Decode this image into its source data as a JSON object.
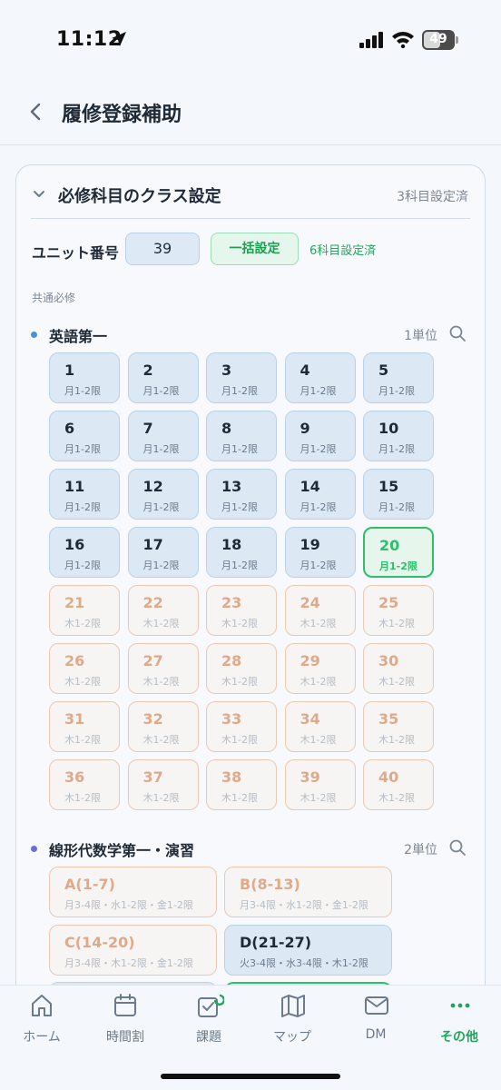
{
  "status_bar": {
    "time": "11:12",
    "battery": "49"
  },
  "header": {
    "title": "履修登録補助"
  },
  "section": {
    "title": "必修科目のクラス設定",
    "status": "3科目設定済",
    "unit_label": "ユニット番号",
    "unit_value": "39",
    "bulk_button": "一括設定",
    "bulk_status": "6科目設定済",
    "category": "共通必修"
  },
  "subjects": [
    {
      "name": "英語第一",
      "credits": "1単位",
      "classes": [
        {
          "num": "1",
          "period": "月1-2限",
          "state": "on"
        },
        {
          "num": "2",
          "period": "月1-2限",
          "state": "on"
        },
        {
          "num": "3",
          "period": "月1-2限",
          "state": "on"
        },
        {
          "num": "4",
          "period": "月1-2限",
          "state": "on"
        },
        {
          "num": "5",
          "period": "月1-2限",
          "state": "on"
        },
        {
          "num": "6",
          "period": "月1-2限",
          "state": "on"
        },
        {
          "num": "7",
          "period": "月1-2限",
          "state": "on"
        },
        {
          "num": "8",
          "period": "月1-2限",
          "state": "on"
        },
        {
          "num": "9",
          "period": "月1-2限",
          "state": "on"
        },
        {
          "num": "10",
          "period": "月1-2限",
          "state": "on"
        },
        {
          "num": "11",
          "period": "月1-2限",
          "state": "on"
        },
        {
          "num": "12",
          "period": "月1-2限",
          "state": "on"
        },
        {
          "num": "13",
          "period": "月1-2限",
          "state": "on"
        },
        {
          "num": "14",
          "period": "月1-2限",
          "state": "on"
        },
        {
          "num": "15",
          "period": "月1-2限",
          "state": "on"
        },
        {
          "num": "16",
          "period": "月1-2限",
          "state": "on"
        },
        {
          "num": "17",
          "period": "月1-2限",
          "state": "on"
        },
        {
          "num": "18",
          "period": "月1-2限",
          "state": "on"
        },
        {
          "num": "19",
          "period": "月1-2限",
          "state": "on"
        },
        {
          "num": "20",
          "period": "月1-2限",
          "state": "sel"
        },
        {
          "num": "21",
          "period": "木1-2限",
          "state": "off"
        },
        {
          "num": "22",
          "period": "木1-2限",
          "state": "off"
        },
        {
          "num": "23",
          "period": "木1-2限",
          "state": "off"
        },
        {
          "num": "24",
          "period": "木1-2限",
          "state": "off"
        },
        {
          "num": "25",
          "period": "木1-2限",
          "state": "off"
        },
        {
          "num": "26",
          "period": "木1-2限",
          "state": "off"
        },
        {
          "num": "27",
          "period": "木1-2限",
          "state": "off"
        },
        {
          "num": "28",
          "period": "木1-2限",
          "state": "off"
        },
        {
          "num": "29",
          "period": "木1-2限",
          "state": "off"
        },
        {
          "num": "30",
          "period": "木1-2限",
          "state": "off"
        },
        {
          "num": "31",
          "period": "木1-2限",
          "state": "off"
        },
        {
          "num": "32",
          "period": "木1-2限",
          "state": "off"
        },
        {
          "num": "33",
          "period": "木1-2限",
          "state": "off"
        },
        {
          "num": "34",
          "period": "木1-2限",
          "state": "off"
        },
        {
          "num": "35",
          "period": "木1-2限",
          "state": "off"
        },
        {
          "num": "36",
          "period": "木1-2限",
          "state": "off"
        },
        {
          "num": "37",
          "period": "木1-2限",
          "state": "off"
        },
        {
          "num": "38",
          "period": "木1-2限",
          "state": "off"
        },
        {
          "num": "39",
          "period": "木1-2限",
          "state": "off"
        },
        {
          "num": "40",
          "period": "木1-2限",
          "state": "off"
        }
      ]
    },
    {
      "name": "線形代数学第一・演習",
      "credits": "2単位",
      "classes": [
        {
          "num": "A(1-7)",
          "period": "月3-4限・水1-2限・金1-2限",
          "state": "off"
        },
        {
          "num": "B(8-13)",
          "period": "月3-4限・水1-2限・金1-2限",
          "state": "off"
        },
        {
          "num": "C(14-20)",
          "period": "月3-4限・木1-2限・金1-2限",
          "state": "off"
        },
        {
          "num": "D(21-27)",
          "period": "火3-4限・水3-4限・木1-2限",
          "state": "on"
        }
      ]
    }
  ],
  "tabs": [
    {
      "label": "ホーム",
      "icon": "home-icon"
    },
    {
      "label": "時間割",
      "icon": "calendar-icon"
    },
    {
      "label": "課題",
      "icon": "task-icon"
    },
    {
      "label": "マップ",
      "icon": "map-icon"
    },
    {
      "label": "DM",
      "icon": "mail-icon"
    },
    {
      "label": "その他",
      "icon": "more-icon",
      "active": true
    }
  ],
  "colors": {
    "accent_green": "#22a55a",
    "class_blue": "#dce9f4",
    "unavailable_border": "#ecc8b2"
  }
}
